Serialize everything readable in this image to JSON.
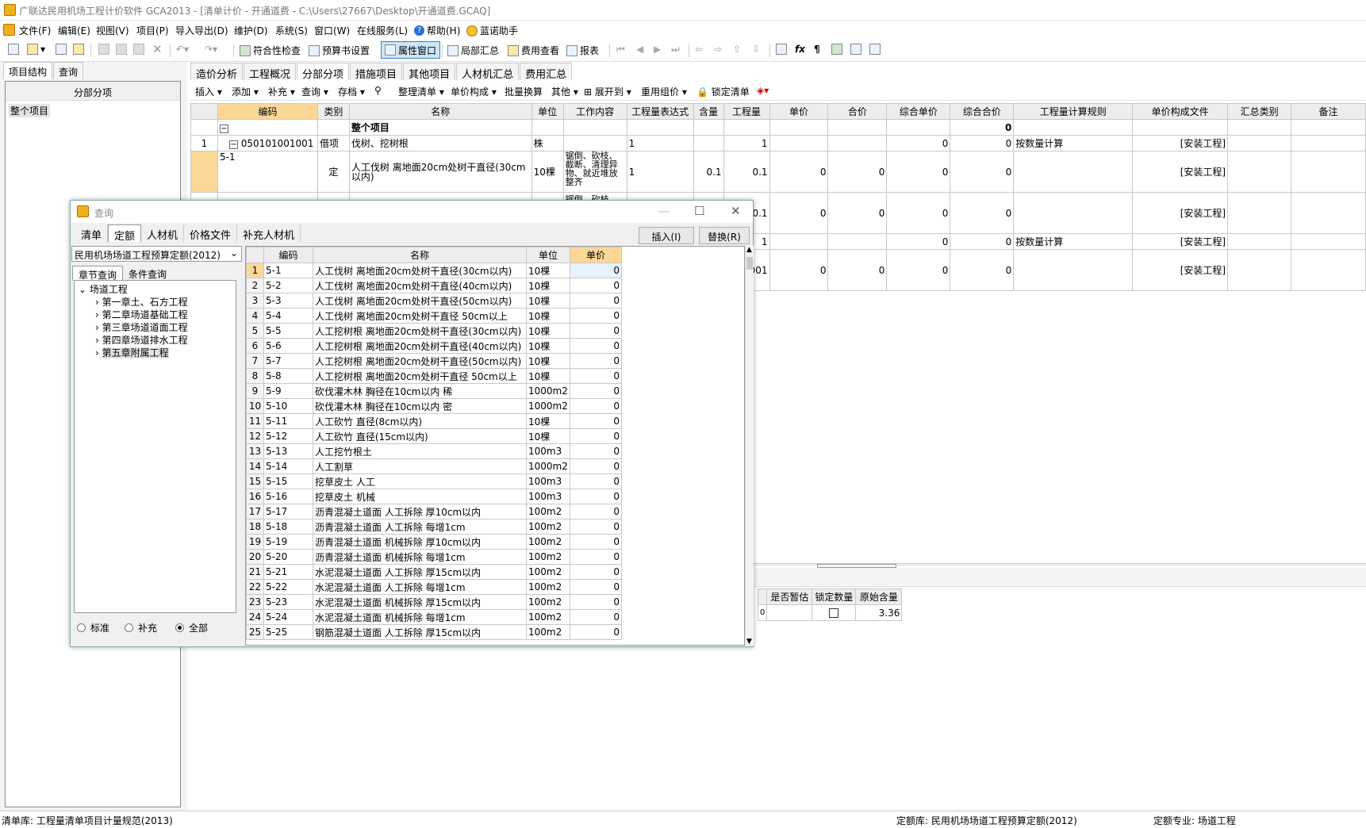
{
  "window": {
    "title": "广联达民用机场工程计价软件 GCA2013 - [清单计价 - 开通道费 - C:\\Users\\27667\\Desktop\\开通道费.GCAQ]"
  },
  "menu": [
    "文件(F)",
    "编辑(E)",
    "视图(V)",
    "项目(P)",
    "导入导出(D)",
    "维护(D)",
    "系统(S)",
    "窗口(W)",
    "在线服务(L)",
    "帮助(H)",
    "蓝诺助手"
  ],
  "toolbar": {
    "check": "符合性检查",
    "budget": "预算书设置",
    "property": "属性窗口",
    "local_sum": "局部汇总",
    "fee_view": "费用查看",
    "report": "报表"
  },
  "left": {
    "tabs": [
      "项目结构",
      "查询"
    ],
    "header": "分部分项",
    "root": "整个项目"
  },
  "main_tabs": [
    "造价分析",
    "工程概况",
    "分部分项",
    "措施项目",
    "其他项目",
    "人材机汇总",
    "费用汇总"
  ],
  "subtoolbar": [
    "插入",
    "添加",
    "补充",
    "查询",
    "存档",
    "整理清单",
    "单价构成",
    "批量换算",
    "其他",
    "展开到",
    "重用组价",
    "锁定清单"
  ],
  "grid": {
    "headers": [
      "编码",
      "类别",
      "名称",
      "单位",
      "工作内容",
      "工程量表达式",
      "含量",
      "工程量",
      "单价",
      "合价",
      "综合单价",
      "综合合价",
      "工程量计算规则",
      "单价构成文件",
      "汇总类别",
      "备注"
    ],
    "group_label": "整个项目",
    "group_total": "0",
    "r1": {
      "no": "1",
      "code": "050101001001",
      "type": "借项",
      "name": "伐树、挖树根",
      "unit": "株",
      "expr": "1",
      "qty": "1",
      "uprice": "0",
      "total": "0",
      "rule": "按数量计算",
      "file": "[安装工程]"
    },
    "r2": {
      "code": "5-1",
      "type": "定",
      "name": "人工伐树 离地面20cm处树干直径(30cm以内)",
      "unit": "10棵",
      "content": "锯倒、砍枝、截断、清理异物、就近堆放整齐",
      "expr": "1",
      "content_qty": "0.1",
      "qty": "0.1",
      "price": "0",
      "sum": "0",
      "uprice": "0",
      "total": "0",
      "file": "[安装工程]"
    },
    "r3": {
      "content_partial": "锯倒、砍枝、",
      "qty_partial": "0.1",
      "price": "0",
      "sum": "0",
      "uprice": "0",
      "total": "0",
      "file": "[安装工程]"
    },
    "r4": {
      "qty_partial": "1",
      "uprice": "0",
      "total": "0",
      "rule": "按数量计算",
      "file": "[安装工程]"
    },
    "r5": {
      "qty_partial": "001",
      "price": "0",
      "sum": "0",
      "uprice": "0",
      "total": "0",
      "file": "[安装工程]"
    }
  },
  "lower": {
    "headers": [
      "是否暂估",
      "锁定数量",
      "原始含量"
    ],
    "partial": "0",
    "orig": "3.36"
  },
  "status": {
    "left": "清单库: 工程量清单项目计量规范(2013)",
    "mid": "定额库: 民用机场场道工程预算定额(2012)",
    "right": "定额专业: 场道工程"
  },
  "dialog": {
    "title": "查询",
    "tabs": [
      "清单",
      "定额",
      "人材机",
      "价格文件",
      "补充人材机"
    ],
    "insert": "插入(I)",
    "replace": "替换(R)",
    "lib": "民用机场场道工程预算定额(2012)",
    "subtabs": [
      "章节查询",
      "条件查询"
    ],
    "tree": [
      "场道工程",
      "第一章土、石方工程",
      "第二章场道基础工程",
      "第三章场道道面工程",
      "第四章场道排水工程",
      "第五章附属工程"
    ],
    "radios": [
      "标准",
      "补充",
      "全部"
    ],
    "headers": [
      "编码",
      "名称",
      "单位",
      "单价"
    ],
    "rows": [
      [
        "1",
        "5-1",
        "人工伐树 离地面20cm处树干直径(30cm以内)",
        "10棵",
        "0"
      ],
      [
        "2",
        "5-2",
        "人工伐树 离地面20cm处树干直径(40cm以内)",
        "10棵",
        "0"
      ],
      [
        "3",
        "5-3",
        "人工伐树 离地面20cm处树干直径(50cm以内)",
        "10棵",
        "0"
      ],
      [
        "4",
        "5-4",
        "人工伐树 离地面20cm处树干直径 50cm以上",
        "10棵",
        "0"
      ],
      [
        "5",
        "5-5",
        "人工挖树根 离地面20cm处树干直径(30cm以内)",
        "10棵",
        "0"
      ],
      [
        "6",
        "5-6",
        "人工挖树根 离地面20cm处树干直径(40cm以内)",
        "10棵",
        "0"
      ],
      [
        "7",
        "5-7",
        "人工挖树根 离地面20cm处树干直径(50cm以内)",
        "10棵",
        "0"
      ],
      [
        "8",
        "5-8",
        "人工挖树根 离地面20cm处树干直径 50cm以上",
        "10棵",
        "0"
      ],
      [
        "9",
        "5-9",
        "砍伐灌木林 胸径在10cm以内 稀",
        "1000m2",
        "0"
      ],
      [
        "10",
        "5-10",
        "砍伐灌木林 胸径在10cm以内 密",
        "1000m2",
        "0"
      ],
      [
        "11",
        "5-11",
        "人工砍竹 直径(8cm以内)",
        "10棵",
        "0"
      ],
      [
        "12",
        "5-12",
        "人工砍竹 直径(15cm以内)",
        "10棵",
        "0"
      ],
      [
        "13",
        "5-13",
        "人工挖竹根土",
        "100m3",
        "0"
      ],
      [
        "14",
        "5-14",
        "人工割草",
        "1000m2",
        "0"
      ],
      [
        "15",
        "5-15",
        "挖草皮土 人工",
        "100m3",
        "0"
      ],
      [
        "16",
        "5-16",
        "挖草皮土 机械",
        "100m3",
        "0"
      ],
      [
        "17",
        "5-17",
        "沥青混凝土道面 人工拆除 厚10cm以内",
        "100m2",
        "0"
      ],
      [
        "18",
        "5-18",
        "沥青混凝土道面 人工拆除 每增1cm",
        "100m2",
        "0"
      ],
      [
        "19",
        "5-19",
        "沥青混凝土道面 机械拆除 厚10cm以内",
        "100m2",
        "0"
      ],
      [
        "20",
        "5-20",
        "沥青混凝土道面 机械拆除 每增1cm",
        "100m2",
        "0"
      ],
      [
        "21",
        "5-21",
        "水泥混凝土道面 人工拆除 厚15cm以内",
        "100m2",
        "0"
      ],
      [
        "22",
        "5-22",
        "水泥混凝土道面 人工拆除 每增1cm",
        "100m2",
        "0"
      ],
      [
        "23",
        "5-23",
        "水泥混凝土道面 机械拆除 厚15cm以内",
        "100m2",
        "0"
      ],
      [
        "24",
        "5-24",
        "水泥混凝土道面 机械拆除 每增1cm",
        "100m2",
        "0"
      ],
      [
        "25",
        "5-25",
        "钢筋混凝土道面 人工拆除 厚15cm以内",
        "100m2",
        "0"
      ]
    ]
  }
}
